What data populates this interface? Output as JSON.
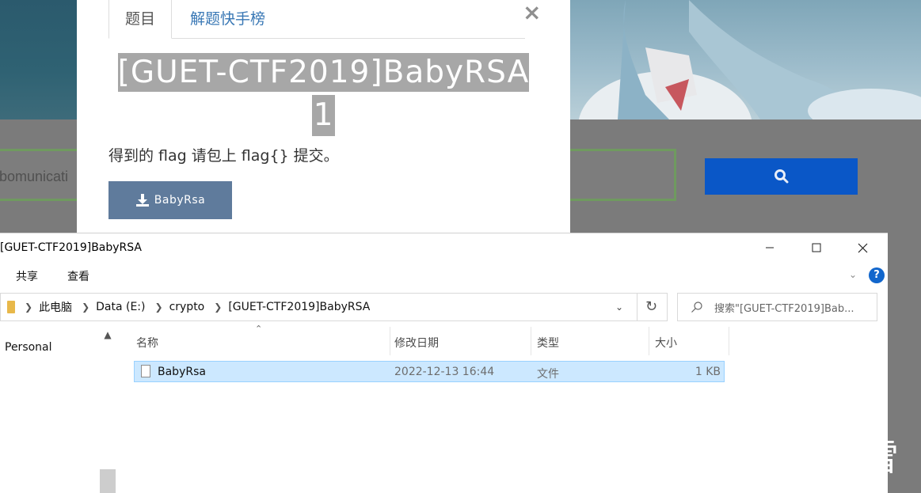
{
  "background": {
    "search_text": "bomunicati"
  },
  "modal": {
    "tabs": [
      "题目",
      "解题快手榜"
    ],
    "close_symbol": "×",
    "title_line1": "[GUET-CTF2019]BabyRSA",
    "title_line2": "1",
    "description": "得到的 flag 请包上 flag{} 提交。",
    "download_label": "BabyRsa"
  },
  "explorer": {
    "window_title": "[GUET-CTF2019]BabyRSA",
    "ribbon": [
      "共享",
      "查看"
    ],
    "breadcrumb": [
      "此电脑",
      "Data (E:)",
      "crypto",
      "[GUET-CTF2019]BabyRSA"
    ],
    "search_placeholder": "搜索\"[GUET-CTF2019]Bab...",
    "sidebar": [
      "Personal"
    ],
    "columns": [
      "名称",
      "修改日期",
      "类型",
      "大小"
    ],
    "files": [
      {
        "name": "BabyRsa",
        "modified": "2022-12-13 16:44",
        "type": "文件",
        "size": "1 KB"
      }
    ]
  },
  "watermark": {
    "text": "看雪"
  },
  "colors": {
    "search_button": "#0a57c7",
    "download_button": "#5f7b9c",
    "selection": "#cce8ff",
    "tab_link": "#3a78b5"
  }
}
